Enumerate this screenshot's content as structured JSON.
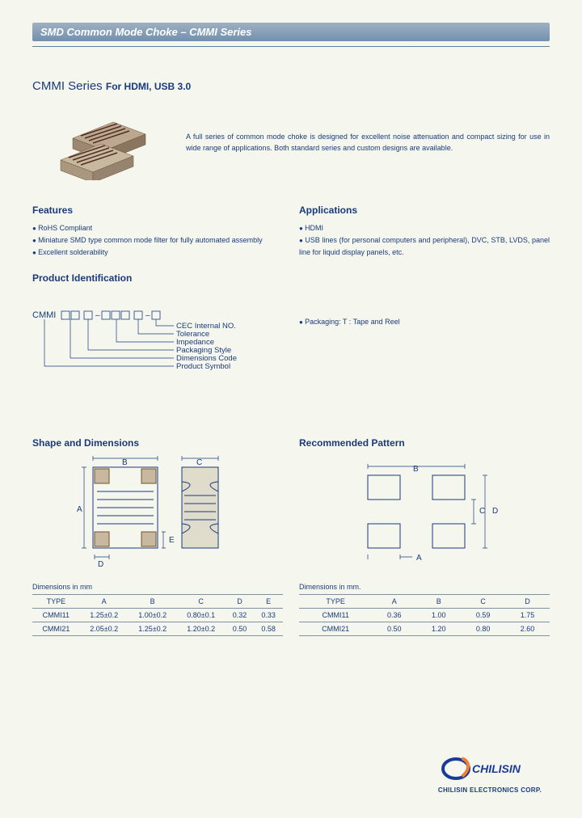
{
  "header": {
    "title": "SMD Common Mode Choke – CMMI Series"
  },
  "series": {
    "name": "CMMI Series",
    "for": "For HDMI, USB 3.0"
  },
  "description": "A full series of common mode choke is designed for excellent noise attenuation and compact sizing for use in wide range of applications. Both standard series and custom designs are available.",
  "features": {
    "heading": "Features",
    "items": [
      "RoHS Compliant",
      "Miniature SMD type common mode filter for fully automated assembly",
      "Excellent solderability"
    ]
  },
  "applications": {
    "heading": "Applications",
    "items": [
      "HDMI",
      "USB lines (for personal computers and peripheral), DVC, STB, LVDS, panel line for liquid display panels, etc."
    ]
  },
  "product_id": {
    "heading": "Product Identification",
    "prefix": "CMMI",
    "labels": [
      "CEC Internal NO.",
      "Tolerance",
      "Impedance",
      "Packaging Style",
      "Dimensions Code",
      "Product Symbol"
    ],
    "packaging_note": "Packaging: T : Tape and Reel"
  },
  "shape": {
    "heading": "Shape and Dimensions",
    "labels": {
      "A": "A",
      "B": "B",
      "C": "C",
      "D": "D",
      "E": "E"
    }
  },
  "pattern": {
    "heading": "Recommended Pattern",
    "labels": {
      "A": "A",
      "B": "B",
      "C": "C",
      "D": "D"
    }
  },
  "dim_table1": {
    "caption": "Dimensions in mm",
    "headers": [
      "TYPE",
      "A",
      "B",
      "C",
      "D",
      "E"
    ],
    "rows": [
      [
        "CMMI11",
        "1.25±0.2",
        "1.00±0.2",
        "0.80±0.1",
        "0.32",
        "0.33"
      ],
      [
        "CMMI21",
        "2.05±0.2",
        "1.25±0.2",
        "1.20±0.2",
        "0.50",
        "0.58"
      ]
    ]
  },
  "dim_table2": {
    "caption": "Dimensions in mm.",
    "headers": [
      "TYPE",
      "A",
      "B",
      "C",
      "D"
    ],
    "rows": [
      [
        "CMMI11",
        "0.36",
        "1.00",
        "0.59",
        "1.75"
      ],
      [
        "CMMI21",
        "0.50",
        "1.20",
        "0.80",
        "2.60"
      ]
    ]
  },
  "logo": {
    "brand": "CHILISIN",
    "corp": "CHILISIN ELECTRONICS CORP."
  }
}
